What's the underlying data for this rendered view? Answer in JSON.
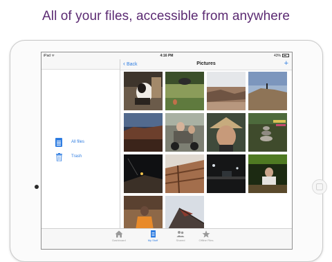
{
  "headline": "All of your files, accessible from anywhere",
  "status_bar": {
    "carrier": "iPad ᯤ",
    "time": "4:16 PM",
    "battery": "43%"
  },
  "sidebar": {
    "items": [
      {
        "label": "All files",
        "icon": "document-icon"
      },
      {
        "label": "Trash",
        "icon": "trash-icon"
      }
    ]
  },
  "nav": {
    "back_label": "Back",
    "title": "Pictures",
    "add_label": "+"
  },
  "photos": [
    {
      "name": "dog-portrait"
    },
    {
      "name": "dog-in-grass"
    },
    {
      "name": "canyon-desert"
    },
    {
      "name": "person-on-rock"
    },
    {
      "name": "mesa-landscape"
    },
    {
      "name": "motorcycle-riders"
    },
    {
      "name": "woman-in-hat"
    },
    {
      "name": "stone-cairn"
    },
    {
      "name": "night-hill"
    },
    {
      "name": "wooden-structure"
    },
    {
      "name": "dark-street"
    },
    {
      "name": "green-room-man"
    },
    {
      "name": "child-in-orange"
    },
    {
      "name": "temple-roof"
    }
  ],
  "tabbar": {
    "tabs": [
      {
        "label": "Dashboard",
        "icon": "home-icon"
      },
      {
        "label": "My Stuff",
        "icon": "document-icon",
        "active": true
      },
      {
        "label": "Shared",
        "icon": "people-icon"
      },
      {
        "label": "Offline Files",
        "icon": "star-icon"
      }
    ]
  },
  "colors": {
    "accent": "#2f7de1",
    "headline": "#5b2a72"
  }
}
